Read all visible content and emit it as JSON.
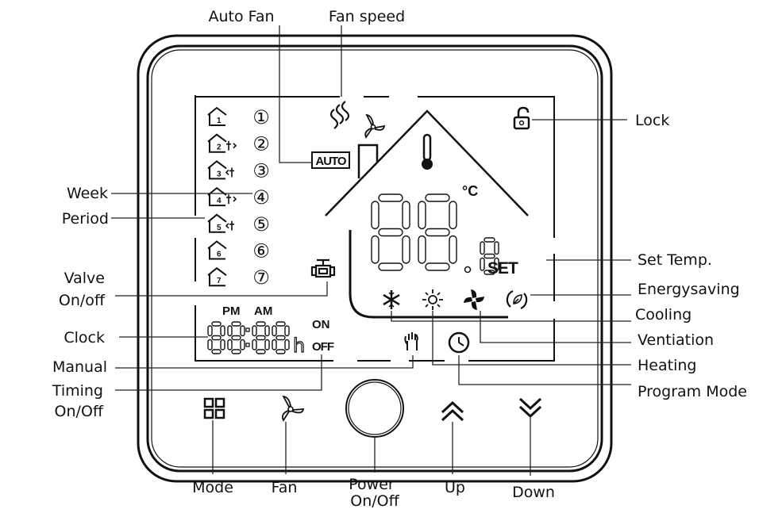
{
  "callouts": {
    "top": {
      "auto_fan": "Auto Fan",
      "fan_speed": "Fan speed"
    },
    "left": {
      "week": "Week",
      "period": "Period",
      "valve_line1": "Valve",
      "valve_line2": "On/off",
      "clock": "Clock",
      "manual": "Manual",
      "timing_line1": "Timing",
      "timing_line2": "On/Off"
    },
    "right": {
      "lock": "Lock",
      "set_temp": "Set Temp.",
      "energysaving": "Energysaving",
      "cooling": "Cooling",
      "ventiation": "Ventiation",
      "heating": "Heating",
      "program_mode": "Program Mode"
    },
    "bottom": {
      "mode": "Mode",
      "fan": "Fan",
      "power_line1": "Power",
      "power_line2": "On/Off",
      "up": "Up",
      "down": "Down"
    }
  },
  "lcd": {
    "auto_badge": "AUTO",
    "set": "SET",
    "pm": "PM",
    "am": "AM",
    "on": "ON",
    "off": "OFF",
    "hour_unit": "h",
    "temp_unit": "°C",
    "week_days": [
      "1",
      "2",
      "3",
      "4",
      "5",
      "6",
      "7"
    ],
    "day_marks": [
      "①",
      "②",
      "③",
      "④",
      "⑤",
      "⑥",
      "⑦"
    ]
  },
  "icons": [
    "lock-icon",
    "thermometer-icon",
    "snowflake-icon",
    "sun-icon",
    "fan-icon",
    "eco-leaf-icon",
    "hand-icon",
    "clock-icon",
    "valve-icon",
    "wind-icon",
    "mode-grid-icon",
    "chevron-up-icon",
    "chevron-down-icon",
    "power-button"
  ],
  "colors": {
    "line": "#111111",
    "background": "#ffffff"
  }
}
